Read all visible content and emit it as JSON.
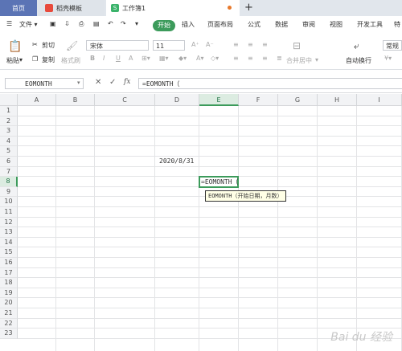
{
  "tabs": {
    "home": "首页",
    "shell": "稻壳模板",
    "file": "工作簿1",
    "add": "+"
  },
  "menu": {
    "file": "文件",
    "start": "开始",
    "insert": "插入",
    "layout": "页面布局",
    "formula": "公式",
    "data": "数据",
    "review": "审阅",
    "view": "视图",
    "dev": "开发工具",
    "more": "特"
  },
  "ribbon": {
    "paste": "粘贴",
    "cut": "剪切",
    "copy": "复制",
    "format_painter": "格式刷",
    "font_name": "宋体",
    "font_size": "11",
    "merge": "合并居中",
    "wrap": "自动换行",
    "number_format": "常规"
  },
  "formula_bar": {
    "name_box": "EOMONTH",
    "cancel": "✕",
    "confirm": "✓",
    "fx": "fx",
    "formula": "=EOMONTH（"
  },
  "columns": [
    "A",
    "B",
    "C",
    "D",
    "E",
    "F",
    "G",
    "H",
    "I"
  ],
  "rows": [
    "1",
    "2",
    "3",
    "4",
    "5",
    "6",
    "7",
    "8",
    "9",
    "10",
    "11",
    "12",
    "13",
    "14",
    "15",
    "16",
    "17",
    "18",
    "19",
    "20",
    "21",
    "22",
    "23"
  ],
  "cells": {
    "D6": "2020/8/31",
    "E8": "=EOMONTH（"
  },
  "tooltip": "EOMONTH（开始日期，月数）",
  "watermark": "Bai du 经验"
}
